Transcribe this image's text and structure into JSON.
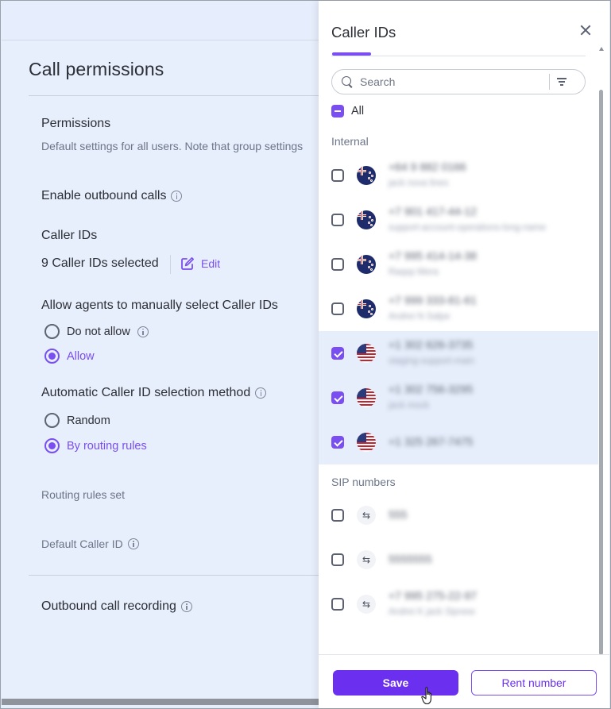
{
  "page": {
    "title": "Call permissions",
    "permissions_title": "Permissions",
    "permissions_desc": "Default settings for all users. Note that group settings",
    "enable_outbound": "Enable outbound calls",
    "caller_ids_label": "Caller IDs",
    "caller_ids_selected": "9 Caller IDs selected",
    "edit_label": "Edit",
    "allow_manual_label": "Allow agents to manually select Caller IDs",
    "manual_options": [
      {
        "label": "Do not allow",
        "selected": false
      },
      {
        "label": "Allow",
        "selected": true
      }
    ],
    "auto_method_label": "Automatic Caller ID selection method",
    "auto_options": [
      {
        "label": "Random",
        "selected": false
      },
      {
        "label": "By routing rules",
        "selected": true
      }
    ],
    "routing_rules_set": "Routing rules set",
    "default_caller_id": "Default Caller ID",
    "outbound_recording": "Outbound call recording"
  },
  "panel": {
    "title": "Caller IDs",
    "search_placeholder": "Search",
    "all_label": "All",
    "groups": [
      {
        "label": "Internal",
        "items": [
          {
            "number": "+64 9 882 0166",
            "name": "jack nova lines",
            "flag": "nz",
            "checked": false
          },
          {
            "number": "+7 901 417-44-12",
            "name": "support-account-operations-long-name",
            "flag": "nz",
            "checked": false
          },
          {
            "number": "+7 995 414-14-38",
            "name": "Raqsp Mera",
            "flag": "nz",
            "checked": false
          },
          {
            "number": "+7 999 333-81-61",
            "name": "Andrei N Salpe",
            "flag": "nz",
            "checked": false
          },
          {
            "number": "+1 302 626-3735",
            "name": "staging-support-main",
            "flag": "us",
            "checked": true
          },
          {
            "number": "+1 302 756-3295",
            "name": "jack mock",
            "flag": "us",
            "checked": true
          },
          {
            "number": "+1 325 267-7475",
            "name": "",
            "flag": "us",
            "checked": true
          }
        ]
      },
      {
        "label": "SIP numbers",
        "items": [
          {
            "number": "555",
            "name": "",
            "flag": "sip",
            "checked": false
          },
          {
            "number": "5555555",
            "name": "",
            "flag": "sip",
            "checked": false
          },
          {
            "number": "+7 995 275-22-97",
            "name": "Andrei K jack Sipnew",
            "flag": "sip",
            "checked": false
          }
        ]
      }
    ],
    "save_label": "Save",
    "rent_label": "Rent number"
  },
  "colors": {
    "accent": "#7a4ef0",
    "save_bg": "#6b2ff0",
    "page_bg": "#e7eefc",
    "selected_row": "#e6eefc"
  }
}
